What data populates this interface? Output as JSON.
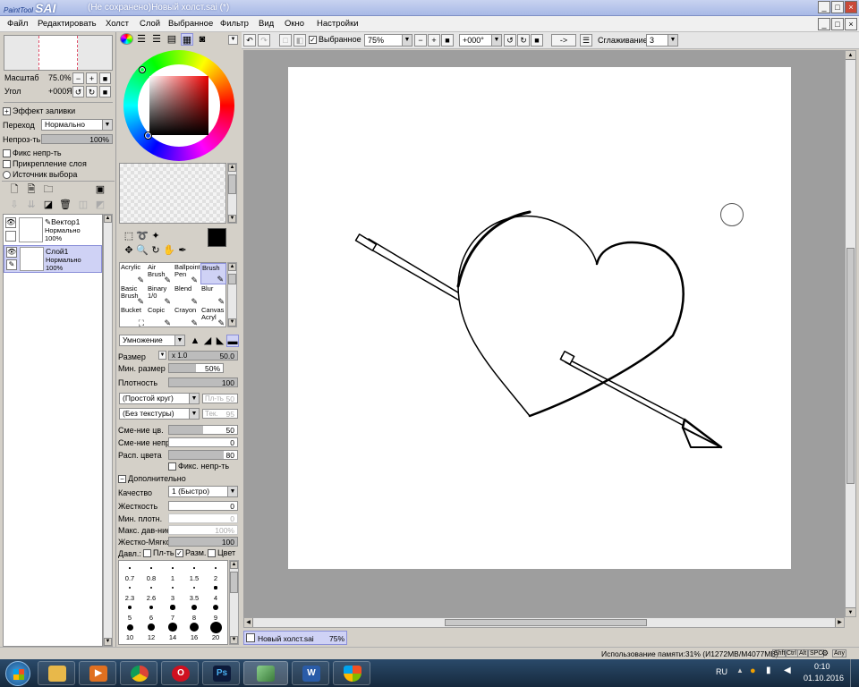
{
  "window": {
    "app_logo_small": "PaintTool",
    "app_logo_big": "SAI",
    "title": "(Не сохранено)Новый холст.sai (*)",
    "min_label": "_",
    "max_label": "□",
    "close_label": "×"
  },
  "menu": [
    "Файл",
    "Редактировать",
    "Холст",
    "Слой",
    "Выбранное",
    "Фильтр",
    "Вид",
    "Окно",
    "Настройки"
  ],
  "menu_right": {
    "min_label": "_",
    "max_label": "□",
    "close_label": "×"
  },
  "toolbar": {
    "selection_label": "Выбранное",
    "selection_checked": true,
    "zoom_value": "75%",
    "rotation_value": "+000°",
    "flip_label": "->",
    "smoothing_label": "Сглаживание",
    "smoothing_value": "3"
  },
  "navigator": {
    "scale_label": "Масштаб",
    "scale_value": "75.0%",
    "angle_label": "Угол",
    "angle_value": "+000Я"
  },
  "layer_effects": {
    "fill_effect_label": "Эффект заливки",
    "blend_label": "Переход",
    "blend_value": "Нормально",
    "opacity_label": "Непроз-ть",
    "opacity_value": "100%",
    "opacity_fraction": 1.0,
    "preserve_opacity_label": "Фикс непр-ть",
    "clip_label": "Прикрепление слоя",
    "selection_source_label": "Источник выбора"
  },
  "layers": [
    {
      "name": "Вектор1",
      "mode": "Нормально",
      "opacity": "100%",
      "selected": false,
      "vector": true
    },
    {
      "name": "Слой1",
      "mode": "Нормально",
      "opacity": "100%",
      "selected": true,
      "vector": false
    }
  ],
  "colors": {
    "primary": "#000000",
    "secondary": "#ffffff",
    "selected_tool_bg": "#cfd2f5",
    "canvas_bg": "#9e9e9e",
    "taskbar": "#1e3550"
  },
  "tools": [
    {
      "name": "Acrylic",
      "selected": false
    },
    {
      "name": "Air Brush",
      "selected": false
    },
    {
      "name": "Ballpoint Pen",
      "selected": false
    },
    {
      "name": "Brush",
      "selected": true
    },
    {
      "name": "Basic Brush",
      "selected": false
    },
    {
      "name": "Binary 1/0",
      "selected": false
    },
    {
      "name": "Blend",
      "selected": false
    },
    {
      "name": "Blur",
      "selected": false
    },
    {
      "name": "Bucket",
      "selected": false
    },
    {
      "name": "Copic",
      "selected": false
    },
    {
      "name": "Crayon",
      "selected": false
    },
    {
      "name": "Canvas Acryl",
      "selected": false
    }
  ],
  "brush": {
    "mode_value": "Умножение",
    "size_label": "Размер",
    "size_mult": "x 1.0",
    "size_value": "50.0",
    "min_size_label": "Мин. размер",
    "min_size_value": "50%",
    "min_size_fraction": 0.5,
    "density_label": "Плотность",
    "density_value": "100",
    "density_fraction": 1.0,
    "shape_value": "(Простой круг)",
    "shape_strength_label": "Пл-ть",
    "shape_strength_value": "50",
    "texture_value": "(Без текстуры)",
    "texture_strength_label": "Тек.",
    "texture_strength_value": "95",
    "blending_label": "Сме-ние цв.",
    "blending_value": "50",
    "blending_fraction": 0.5,
    "dilution_label": "Сме-ние непр.",
    "dilution_value": "0",
    "dilution_fraction": 0.0,
    "persistence_label": "Расп. цвета",
    "persistence_value": "80",
    "persistence_fraction": 0.8,
    "keep_opacity_label": "Фикс. непр-ть",
    "advanced_label": "Дополнительно",
    "quality_label": "Качество",
    "quality_value": "1 (Быстро)",
    "edge_hardness_label": "Жесткость",
    "edge_hardness_value": "0",
    "min_density_label": "Мин. плотн.",
    "min_density_value": "0",
    "max_pressure_label": "Макс. дав-ние",
    "max_pressure_value": "100%",
    "hard_soft_label": "Жестко-Мягко",
    "hard_soft_value": "100",
    "hard_soft_fraction": 1.0,
    "pressure_label": "Давл.:",
    "pressure_density_label": "Пл-ть",
    "pressure_density_checked": false,
    "pressure_size_label": "Разм.",
    "pressure_size_checked": true,
    "pressure_color_label": "Цвет",
    "pressure_color_checked": false
  },
  "brush_sizes": [
    "0.7",
    "0.8",
    "1",
    "1.5",
    "2",
    "2.3",
    "2.6",
    "3",
    "3.5",
    "4",
    "5",
    "6",
    "7",
    "8",
    "9",
    "10",
    "12",
    "14",
    "16",
    "20"
  ],
  "canvas_tab": {
    "name": "Новый холст.sai",
    "zoom": "75%"
  },
  "status": {
    "memory": "Использование памяти:31% (И1272MB/M4077MB)",
    "keys": [
      "Shft",
      "Ctrl",
      "Alt",
      "SPC",
      "Any"
    ]
  },
  "taskbar": {
    "language": "RU",
    "time": "0:10",
    "date": "01.10.2016",
    "apps": [
      "start-button",
      "explorer",
      "media-player",
      "chrome",
      "opera",
      "photoshop",
      "paint-tool-sai",
      "word",
      "security-center"
    ]
  }
}
